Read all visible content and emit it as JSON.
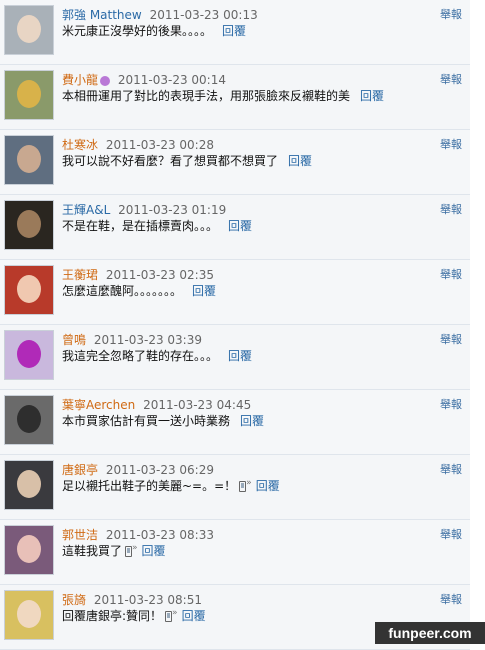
{
  "report_label": "舉報",
  "reply_label": "回覆",
  "watermark": "funpeer.com",
  "comments": [
    {
      "name": "郭強 Matthew",
      "time": "2011-03-23 00:13",
      "text": "米元康正沒學好的後果。。。。"
    },
    {
      "name": "費小龍",
      "time": "2011-03-23 00:14",
      "text": "本相冊運用了對比的表現手法，用那張臉來反襯鞋的美"
    },
    {
      "name": "杜寒冰",
      "time": "2011-03-23 00:28",
      "text": "我可以說不好看麼？看了想買都不想買了"
    },
    {
      "name": "王輝A&L",
      "time": "2011-03-23 01:19",
      "text": "不是在鞋，是在插標賣肉。。。"
    },
    {
      "name": "王蘅珺",
      "time": "2011-03-23 02:35",
      "text": "怎麼這麼醜阿。。。。。。。"
    },
    {
      "name": "曾鳴",
      "time": "2011-03-23 03:39",
      "text": "我這完全忽略了鞋的存在。。。"
    },
    {
      "name": "葉寧Aerchen",
      "time": "2011-03-23 04:45",
      "text": "本市買家估計有買一送小時業務"
    },
    {
      "name": "唐銀亭",
      "time": "2011-03-23 06:29",
      "text": "足以襯托出鞋子的美麗~=。=！"
    },
    {
      "name": "郭世洁",
      "time": "2011-03-23 08:33",
      "text": "這鞋我買了"
    },
    {
      "name": "張旖",
      "time": "2011-03-23 08:51",
      "text": "回覆唐銀亭:贊同！"
    }
  ],
  "colors": {
    "name_blue": "#2b6aa6",
    "name_orange": "#d06a14",
    "link": "#2b6aa6",
    "row_bg": "#f4f6f8"
  },
  "icons": {
    "vip": "vip-badge-icon",
    "mobile": "mobile-phone-icon"
  }
}
